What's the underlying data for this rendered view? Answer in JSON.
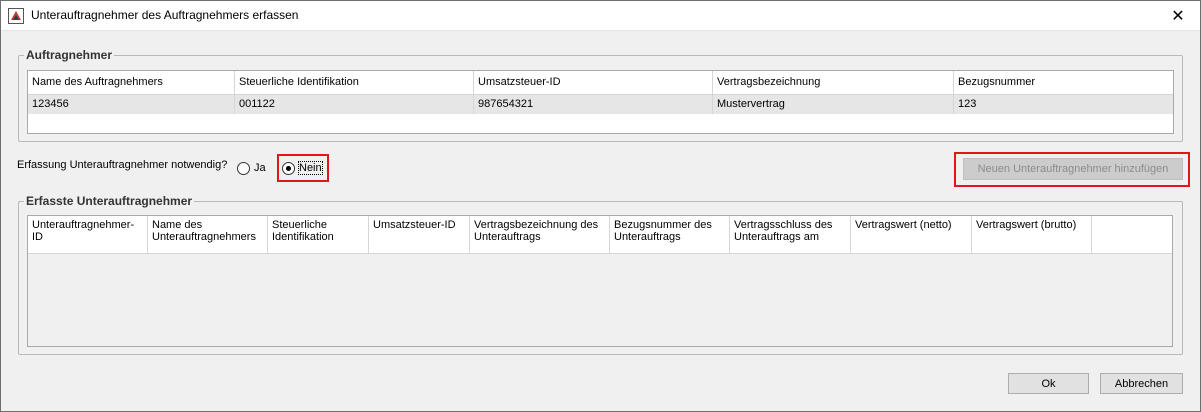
{
  "window": {
    "title": "Unterauftragnehmer des Auftragnehmers erfassen",
    "close_glyph": "✕"
  },
  "contractor_group": {
    "title": "Auftragnehmer",
    "columns": [
      "Name des Auftragnehmers",
      "Steuerliche Identifikation",
      "Umsatzsteuer-ID",
      "Vertragsbezeichnung",
      "Bezugsnummer"
    ],
    "row": [
      "123456",
      "001122",
      "987654321",
      "Mustervertrag",
      "123"
    ]
  },
  "subcontractor_question": {
    "label": "Erfassung Unterauftragnehmer notwendig?",
    "options": [
      "Ja",
      "Nein"
    ],
    "selected": "Nein"
  },
  "add_button_label": "Neuen Unterauftragnehmer hinzufügen",
  "subcontractors_group": {
    "title": "Erfasste Unterauftragnehmer",
    "columns": [
      "Unterauftragnehmer-ID",
      "Name des Unterauftragnehmers",
      "Steuerliche Identifikation",
      "Umsatzsteuer-ID",
      "Vertragsbezeichnung des Unterauftrags",
      "Bezugsnummer des Unterauftrags",
      "Vertragsschluss des Unterauftrags am",
      "Vertragswert (netto)",
      "Vertragswert (brutto)"
    ]
  },
  "footer": {
    "ok_label": "Ok",
    "cancel_label": "Abbrechen"
  },
  "colors": {
    "highlight": "#e0161b",
    "background": "#f0f0f0"
  },
  "icons": {
    "app": "app-icon",
    "close": "close-icon"
  }
}
